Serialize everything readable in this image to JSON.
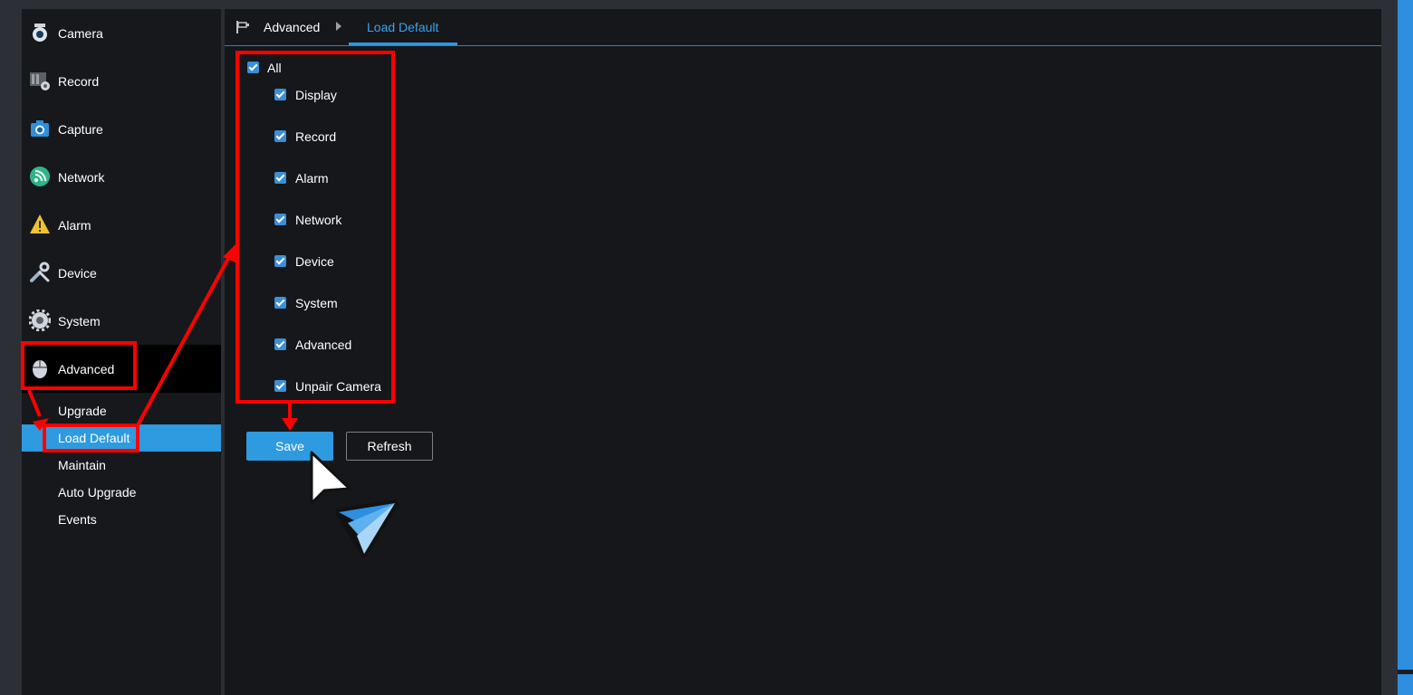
{
  "sidebar": {
    "items": [
      {
        "label": "Camera",
        "icon": "camera-icon"
      },
      {
        "label": "Record",
        "icon": "record-icon"
      },
      {
        "label": "Capture",
        "icon": "capture-icon"
      },
      {
        "label": "Network",
        "icon": "network-icon"
      },
      {
        "label": "Alarm",
        "icon": "alarm-icon"
      },
      {
        "label": "Device",
        "icon": "device-icon"
      },
      {
        "label": "System",
        "icon": "system-icon"
      },
      {
        "label": "Advanced",
        "icon": "advanced-icon"
      }
    ],
    "subitems": [
      "Upgrade",
      "Load Default",
      "Maintain",
      "Auto Upgrade",
      "Events"
    ],
    "selected_subitem": "Load Default"
  },
  "breadcrumb": {
    "parent": "Advanced",
    "current": "Load Default"
  },
  "options": {
    "all": {
      "label": "All",
      "checked": true
    },
    "items": [
      {
        "label": "Display",
        "checked": true
      },
      {
        "label": "Record",
        "checked": true
      },
      {
        "label": "Alarm",
        "checked": true
      },
      {
        "label": "Network",
        "checked": true
      },
      {
        "label": "Device",
        "checked": true
      },
      {
        "label": "System",
        "checked": true
      },
      {
        "label": "Advanced",
        "checked": true
      },
      {
        "label": "Unpair Camera",
        "checked": true
      }
    ]
  },
  "buttons": {
    "save": "Save",
    "refresh": "Refresh"
  },
  "colors": {
    "accent": "#2e9ae0",
    "annotation": "#ff0000",
    "background": "#15171b"
  }
}
